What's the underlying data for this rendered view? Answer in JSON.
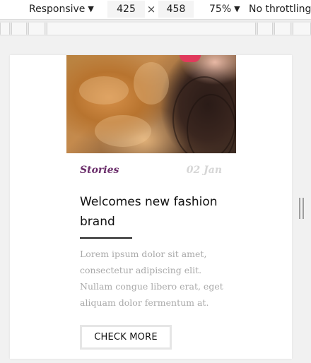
{
  "devtools": {
    "device": "Responsive",
    "width": "425",
    "times": "×",
    "height": "458",
    "zoom": "75%",
    "throttle": "No throttling",
    "dropdown_icon": "chevron-down-icon"
  },
  "card": {
    "category": "Stories",
    "date": "02 Jan",
    "title": "Welcomes new fashion brand",
    "excerpt": "Lorem ipsum dolor sit amet, consectetur adipiscing elit. Nullam congue libero erat, eget aliquam dolor fermentum at.",
    "cta_label": "CHECK MORE"
  },
  "colors": {
    "category": "#6a2d6a",
    "date": "#d6d6d6",
    "excerpt": "#a9a9a9",
    "title": "#111111",
    "rule": "#222222"
  }
}
